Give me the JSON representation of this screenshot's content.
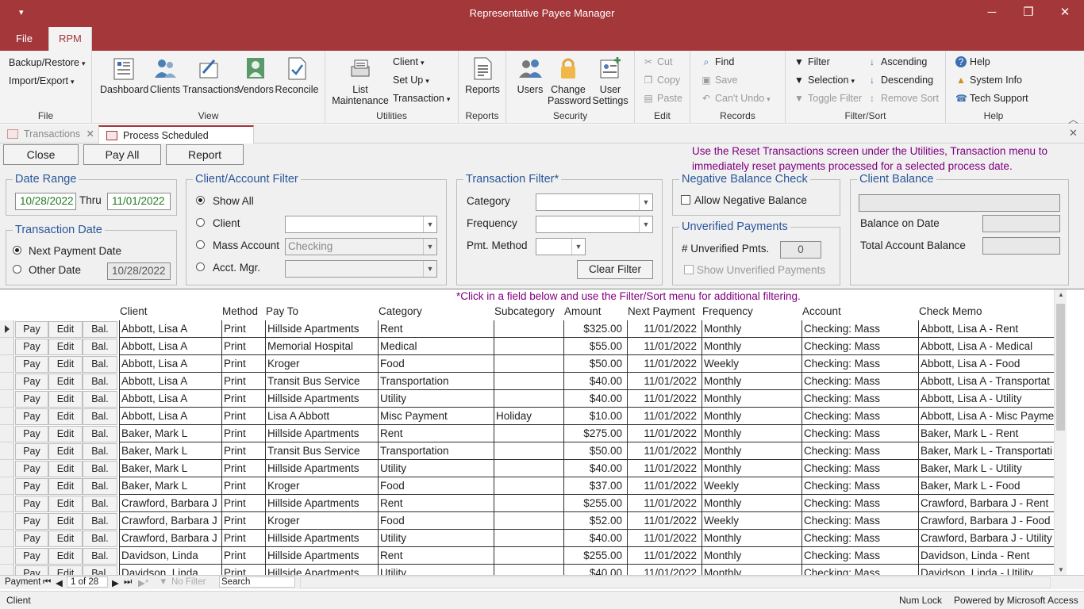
{
  "app": {
    "title": "Representative Payee Manager",
    "quick_access_icon": "dropdown-arrow-icon",
    "window_controls": [
      "minimize-icon",
      "restore-icon",
      "close-icon"
    ]
  },
  "menu": {
    "tabs": [
      "File",
      "RPM"
    ],
    "active": "RPM"
  },
  "ribbon": {
    "file_group": {
      "label": "File",
      "items": [
        "Backup/Restore",
        "Import/Export"
      ]
    },
    "view_group": {
      "label": "View",
      "items": [
        "Dashboard",
        "Clients",
        "Transactions",
        "Vendors",
        "Reconcile"
      ]
    },
    "utilities_group": {
      "label": "Utilities",
      "list_maintenance_1": "List",
      "list_maintenance_2": "Maintenance",
      "items": [
        "Client",
        "Set Up",
        "Transaction"
      ]
    },
    "reports_group": {
      "label": "Reports",
      "button": "Reports"
    },
    "security_group": {
      "label": "Security",
      "users": "Users",
      "change_pw_1": "Change",
      "change_pw_2": "Password",
      "user_settings_1": "User",
      "user_settings_2": "Settings"
    },
    "edit_group": {
      "label": "Edit",
      "items": [
        "Cut",
        "Copy",
        "Paste"
      ]
    },
    "records_group": {
      "label": "Records",
      "items": [
        "Find",
        "Save",
        "Can't Undo"
      ]
    },
    "filter_group": {
      "label": "Filter/Sort",
      "items": [
        "Filter",
        "Selection",
        "Toggle Filter",
        "Ascending",
        "Descending",
        "Remove Sort"
      ]
    },
    "help_group": {
      "label": "Help",
      "items": [
        "Help",
        "System Info",
        "Tech Support"
      ]
    }
  },
  "doc_tabs": [
    "Transactions",
    "Process Scheduled Payments"
  ],
  "form": {
    "buttons": {
      "close": "Close",
      "pay_all": "Pay All",
      "report": "Report",
      "clear_filter": "Clear Filter"
    },
    "notice": "Use the Reset Transactions screen under the Utilities, Transaction menu to immediately reset payments processed for a selected process date.",
    "date_range": {
      "title": "Date Range",
      "from": "10/28/2022",
      "thru_label": "Thru",
      "to": "11/01/2022"
    },
    "transaction_date": {
      "title": "Transaction Date",
      "next_label": "Next Payment Date",
      "other_label": "Other Date",
      "other_value": "10/28/2022"
    },
    "client_filter": {
      "title": "Client/Account Filter",
      "show_all": "Show All",
      "client": "Client",
      "mass_account": "Mass Account",
      "mass_account_value": "Checking",
      "acct_mgr": "Acct. Mgr."
    },
    "transaction_filter": {
      "title": "Transaction Filter*",
      "category": "Category",
      "frequency": "Frequency",
      "pmt_method": "Pmt. Method"
    },
    "negative_balance": {
      "title": "Negative Balance Check",
      "allow_label": "Allow Negative Balance"
    },
    "unverified": {
      "title": "Unverified Payments",
      "count_label": "# Unverified Pmts.",
      "count": "0",
      "show_label": "Show Unverified Payments"
    },
    "client_balance": {
      "title": "Client Balance",
      "balance_on_date": "Balance on Date",
      "total_account_balance": "Total Account Balance"
    }
  },
  "grid": {
    "hint": "*Click in a field below and use the Filter/Sort menu for additional filtering.",
    "button_labels": {
      "pay": "Pay",
      "edit": "Edit",
      "bal": "Bal."
    },
    "columns": [
      "Client",
      "Method",
      "Pay To",
      "Category",
      "Subcategory",
      "Amount",
      "Next Payment",
      "Frequency",
      "Account",
      "Check Memo"
    ],
    "rows": [
      [
        "Abbott, Lisa A",
        "Print",
        "Hillside Apartments",
        "Rent",
        "",
        "$325.00",
        "11/01/2022",
        "Monthly",
        "Checking: Mass",
        "Abbott, Lisa A - Rent"
      ],
      [
        "Abbott, Lisa A",
        "Print",
        "Memorial Hospital",
        "Medical",
        "",
        "$55.00",
        "11/01/2022",
        "Monthly",
        "Checking: Mass",
        "Abbott, Lisa A - Medical"
      ],
      [
        "Abbott, Lisa A",
        "Print",
        "Kroger",
        "Food",
        "",
        "$50.00",
        "11/01/2022",
        "Weekly",
        "Checking: Mass",
        "Abbott, Lisa A - Food"
      ],
      [
        "Abbott, Lisa A",
        "Print",
        "Transit Bus Service",
        "Transportation",
        "",
        "$40.00",
        "11/01/2022",
        "Monthly",
        "Checking: Mass",
        "Abbott, Lisa A - Transportat"
      ],
      [
        "Abbott, Lisa A",
        "Print",
        "Hillside Apartments",
        "Utility",
        "",
        "$40.00",
        "11/01/2022",
        "Monthly",
        "Checking: Mass",
        "Abbott, Lisa A - Utility"
      ],
      [
        "Abbott, Lisa A",
        "Print",
        "Lisa A Abbott",
        "Misc Payment",
        "Holiday",
        "$10.00",
        "11/01/2022",
        "Monthly",
        "Checking: Mass",
        "Abbott, Lisa A - Misc Payme"
      ],
      [
        "Baker, Mark L",
        "Print",
        "Hillside Apartments",
        "Rent",
        "",
        "$275.00",
        "11/01/2022",
        "Monthly",
        "Checking: Mass",
        "Baker, Mark L - Rent"
      ],
      [
        "Baker, Mark L",
        "Print",
        "Transit Bus Service",
        "Transportation",
        "",
        "$50.00",
        "11/01/2022",
        "Monthly",
        "Checking: Mass",
        "Baker, Mark L - Transportati"
      ],
      [
        "Baker, Mark L",
        "Print",
        "Hillside Apartments",
        "Utility",
        "",
        "$40.00",
        "11/01/2022",
        "Monthly",
        "Checking: Mass",
        "Baker, Mark L - Utility"
      ],
      [
        "Baker, Mark L",
        "Print",
        "Kroger",
        "Food",
        "",
        "$37.00",
        "11/01/2022",
        "Weekly",
        "Checking: Mass",
        "Baker, Mark L - Food"
      ],
      [
        "Crawford, Barbara J",
        "Print",
        "Hillside Apartments",
        "Rent",
        "",
        "$255.00",
        "11/01/2022",
        "Monthly",
        "Checking: Mass",
        "Crawford, Barbara J - Rent"
      ],
      [
        "Crawford, Barbara J",
        "Print",
        "Kroger",
        "Food",
        "",
        "$52.00",
        "11/01/2022",
        "Weekly",
        "Checking: Mass",
        "Crawford, Barbara J - Food"
      ],
      [
        "Crawford, Barbara J",
        "Print",
        "Hillside Apartments",
        "Utility",
        "",
        "$40.00",
        "11/01/2022",
        "Monthly",
        "Checking: Mass",
        "Crawford, Barbara J - Utility"
      ],
      [
        "Davidson, Linda",
        "Print",
        "Hillside Apartments",
        "Rent",
        "",
        "$255.00",
        "11/01/2022",
        "Monthly",
        "Checking: Mass",
        "Davidson, Linda - Rent"
      ],
      [
        "Davidson, Linda",
        "Print",
        "Hillside Apartments",
        "Utility",
        "",
        "$40.00",
        "11/01/2022",
        "Monthly",
        "Checking: Mass",
        "Davidson, Linda - Utility"
      ]
    ]
  },
  "record_nav": {
    "label": "Payment",
    "position": "1 of 28",
    "no_filter": "No Filter",
    "search": "Search"
  },
  "status": {
    "left": "Client",
    "num_lock": "Num Lock",
    "powered": "Powered by Microsoft Access"
  }
}
